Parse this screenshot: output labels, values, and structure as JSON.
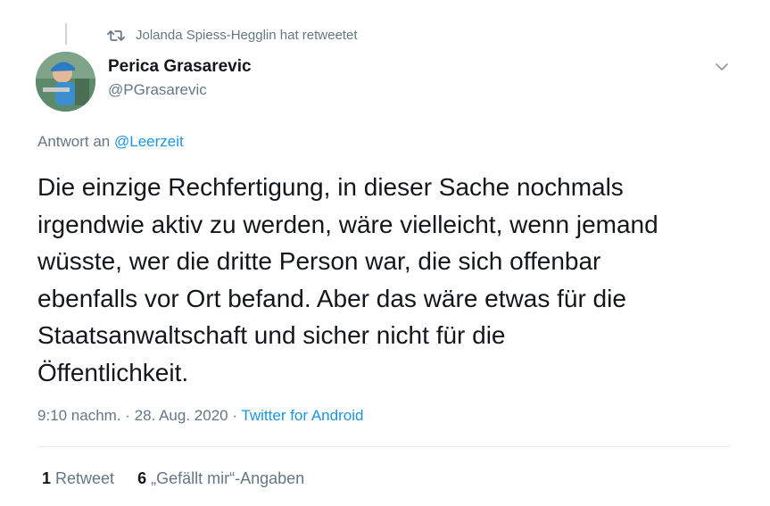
{
  "retweet_context": {
    "icon": "retweet-icon",
    "text": "Jolanda Spiess-Hegglin hat retweetet"
  },
  "author": {
    "name": "Perica Grasarevic",
    "handle": "@PGrasarevic"
  },
  "reply": {
    "prefix": "Antwort an",
    "mention": "@Leerzeit"
  },
  "tweet": {
    "text": "Die einzige Rechfertigung, in dieser Sache nochmals\nirgendwie aktiv zu werden, wäre vielleicht, wenn jemand\nwüsste, wer die dritte Person war, die sich offenbar\nebenfalls vor Ort befand. Aber das wäre etwas für die\nStaatsanwaltschaft und sicher nicht für die\nÖffentlichkeit."
  },
  "meta": {
    "time": "9:10 nachm.",
    "separator1": " · ",
    "date": "28. Aug. 2020",
    "separator2": " · ",
    "source": "Twitter for Android"
  },
  "stats": {
    "retweets_count": "1",
    "retweets_label": "Retweet",
    "likes_count": "6",
    "likes_label": "„Gefällt mir“-Angaben"
  },
  "colors": {
    "link": "#1b95e0",
    "secondary": "#657786",
    "primary": "#14171a"
  }
}
